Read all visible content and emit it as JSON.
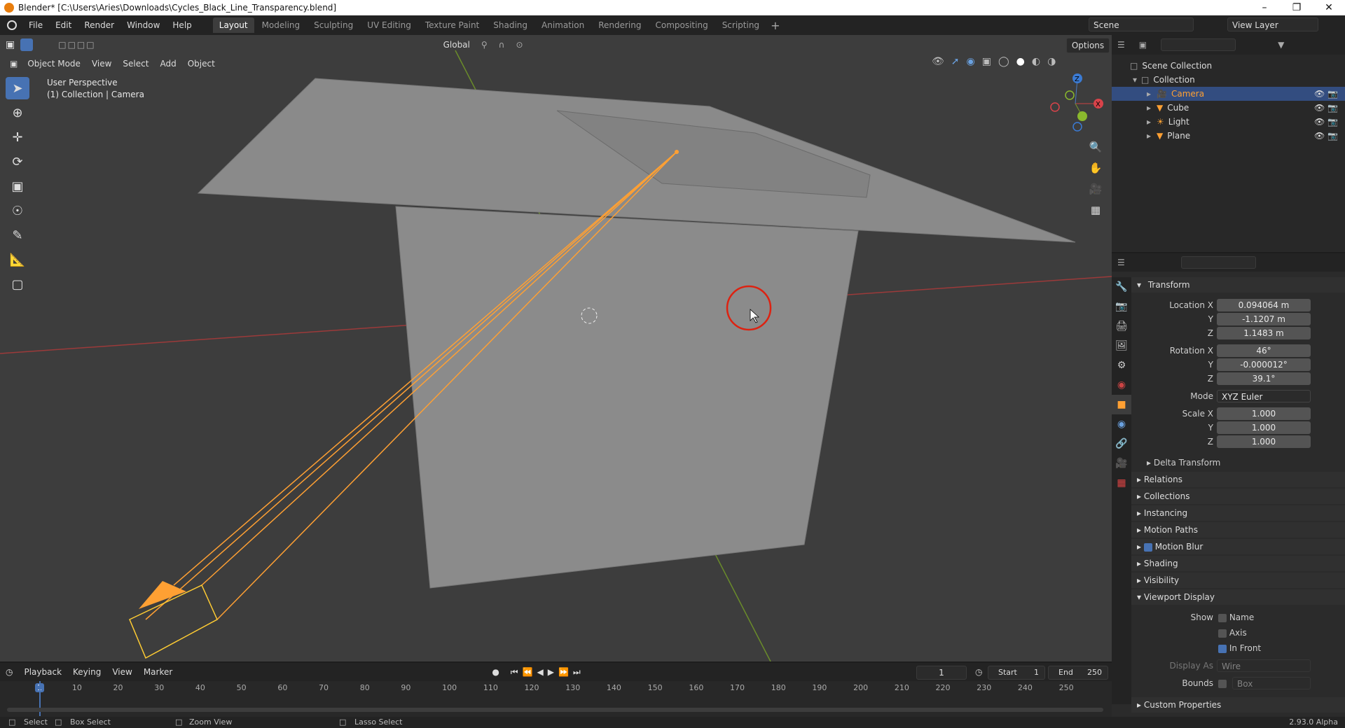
{
  "window": {
    "title": "Blender* [C:\\Users\\Aries\\Downloads\\Cycles_Black_Line_Transparency.blend]",
    "controls": [
      "–",
      "❐",
      "✕"
    ]
  },
  "menu": [
    "File",
    "Edit",
    "Render",
    "Window",
    "Help"
  ],
  "workspaces": [
    {
      "label": "Layout",
      "active": true
    },
    {
      "label": "Modeling"
    },
    {
      "label": "Sculpting"
    },
    {
      "label": "UV Editing"
    },
    {
      "label": "Texture Paint"
    },
    {
      "label": "Shading"
    },
    {
      "label": "Animation"
    },
    {
      "label": "Rendering"
    },
    {
      "label": "Compositing"
    },
    {
      "label": "Scripting"
    }
  ],
  "scene": {
    "label": "Scene",
    "view_layer": "View Layer"
  },
  "viewport": {
    "mode": "Object Mode",
    "menus": [
      "View",
      "Select",
      "Add",
      "Object"
    ],
    "transform_orientation": "Global",
    "options_label": "Options",
    "info_line1": "User Perspective",
    "info_line2": "(1) Collection | Camera",
    "gizmo_axes": [
      "X",
      "Y",
      "Z"
    ]
  },
  "outliner": {
    "root": "Scene Collection",
    "collection": "Collection",
    "objects": [
      {
        "name": "Camera",
        "selected": true,
        "icon": "camera-icon"
      },
      {
        "name": "Cube",
        "icon": "mesh-icon"
      },
      {
        "name": "Light",
        "icon": "light-icon"
      },
      {
        "name": "Plane",
        "icon": "mesh-icon"
      }
    ]
  },
  "properties": {
    "transform_title": "Transform",
    "location_label": "Location X",
    "location": [
      "0.094064 m",
      "-1.1207 m",
      "1.1483 m"
    ],
    "rotation_label": "Rotation X",
    "rotation": [
      "46°",
      "-0.000012°",
      "39.1°"
    ],
    "mode_label": "Mode",
    "mode_value": "XYZ Euler",
    "scale_label": "Scale X",
    "scale": [
      "1.000",
      "1.000",
      "1.000"
    ],
    "y_label": "Y",
    "z_label": "Z",
    "delta_transform": "Delta Transform",
    "sections": [
      "Relations",
      "Collections",
      "Instancing",
      "Motion Paths",
      "Motion Blur",
      "Shading",
      "Visibility"
    ],
    "viewport_display": "Viewport Display",
    "show_label": "Show",
    "show_name": "Name",
    "show_axis": "Axis",
    "show_in_front": "In Front",
    "display_as_label": "Display As",
    "display_as_value": "Wire",
    "bounds_label": "Bounds",
    "bounds_value": "Box",
    "custom_properties": "Custom Properties"
  },
  "timeline": {
    "menus": [
      "Playback",
      "Keying",
      "View",
      "Marker"
    ],
    "current_frame": "1",
    "start_label": "Start",
    "start": "1",
    "end_label": "End",
    "end": "250",
    "ruler": [
      "1",
      "10",
      "20",
      "30",
      "40",
      "50",
      "60",
      "70",
      "80",
      "90",
      "100",
      "110",
      "120",
      "130",
      "140",
      "150",
      "160",
      "170",
      "180",
      "190",
      "200",
      "210",
      "220",
      "230",
      "240",
      "250"
    ]
  },
  "status": {
    "select": "Select",
    "box_select": "Box Select",
    "zoom_view": "Zoom View",
    "lasso_select": "Lasso Select",
    "version": "2.93.0 Alpha"
  },
  "colors": {
    "accent": "#4772b3",
    "selected_object": "#ffa033",
    "axis_x": "#9c3a3a",
    "axis_y": "#6a8c2a"
  }
}
